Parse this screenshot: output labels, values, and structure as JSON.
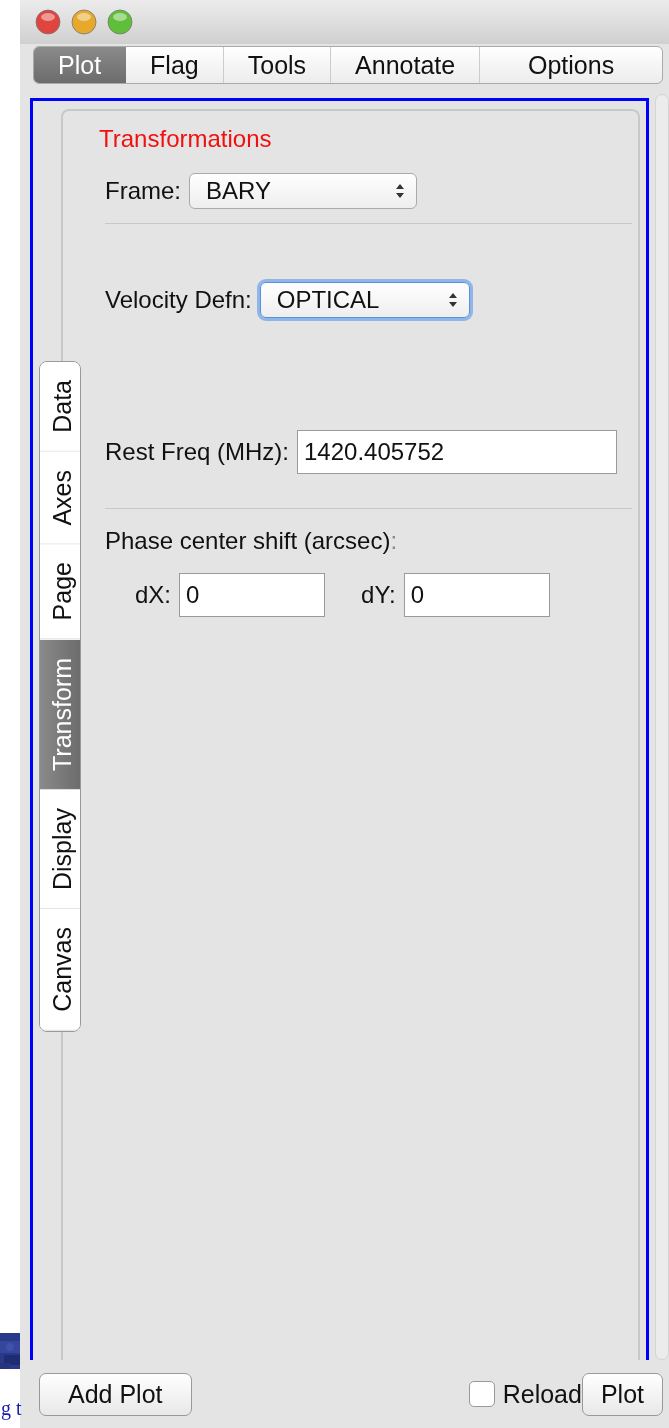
{
  "background": {
    "link_text": "g t"
  },
  "tabs": [
    {
      "label": "Plot",
      "selected": true
    },
    {
      "label": "Flag",
      "selected": false
    },
    {
      "label": "Tools",
      "selected": false
    },
    {
      "label": "Annotate",
      "selected": false
    },
    {
      "label": "Options",
      "selected": false
    }
  ],
  "side_tabs": [
    {
      "label": "Data",
      "selected": false
    },
    {
      "label": "Axes",
      "selected": false
    },
    {
      "label": "Page",
      "selected": false
    },
    {
      "label": "Transform",
      "selected": true
    },
    {
      "label": "Display",
      "selected": false
    },
    {
      "label": "Canvas",
      "selected": false
    }
  ],
  "panel": {
    "title": "Transformations",
    "frame": {
      "label": "Frame:",
      "value": "BARY",
      "focused": false
    },
    "velocity": {
      "label": "Velocity Defn:",
      "value": "OPTICAL",
      "focused": true
    },
    "rest_freq": {
      "label": "Rest Freq (MHz):",
      "value": "1420.405752"
    },
    "phase_shift": {
      "label": "Phase center shift (arcsec)",
      "colon": ":",
      "dx": {
        "label": "dX:",
        "value": "0"
      },
      "dy": {
        "label": "dY:",
        "value": "0"
      }
    }
  },
  "bottom": {
    "add_plot": "Add Plot",
    "reload": {
      "label": "Reload",
      "checked": false
    },
    "plot": "Plot"
  }
}
